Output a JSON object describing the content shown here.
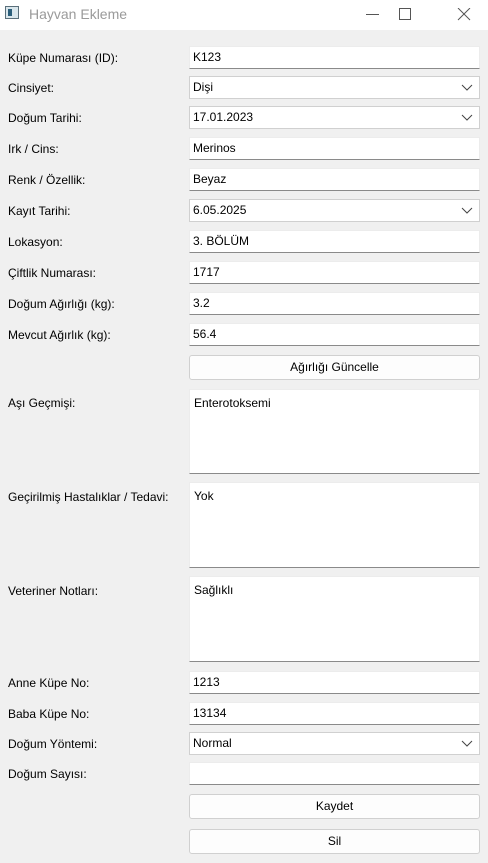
{
  "window": {
    "title": "Hayvan Ekleme",
    "icons": {
      "app": "app-window-icon",
      "minimize": "minimize-icon",
      "maximize": "maximize-icon",
      "close": "close-icon"
    }
  },
  "form": {
    "ear_tag": {
      "label": "Küpe Numarası (ID):",
      "value": "K123"
    },
    "sex": {
      "label": "Cinsiyet:",
      "value": "Dişi"
    },
    "birth_date": {
      "label": "Doğum Tarihi:",
      "value": "17.01.2023"
    },
    "breed": {
      "label": "Irk / Cins:",
      "value": "Merinos"
    },
    "color": {
      "label": "Renk / Özellik:",
      "value": "Beyaz"
    },
    "record_date": {
      "label": "Kayıt Tarihi:",
      "value": "6.05.2025"
    },
    "location": {
      "label": "Lokasyon:",
      "value": "3. BÖLÜM"
    },
    "farm_no": {
      "label": "Çiftlik Numarası:",
      "value": "1717"
    },
    "birth_weight": {
      "label": "Doğum Ağırlığı (kg):",
      "value": "3.2"
    },
    "current_weight": {
      "label": "Mevcut Ağırlık (kg):",
      "value": "56.4"
    },
    "update_weight_button": "Ağırlığı Güncelle",
    "vaccination": {
      "label": "Aşı Geçmişi:",
      "value": "Enterotoksemi"
    },
    "diseases": {
      "label": "Geçirilmiş Hastalıklar / Tedavi:",
      "value": "Yok"
    },
    "vet_notes": {
      "label": "Veteriner Notları:",
      "value": "Sağlıklı"
    },
    "mother_tag": {
      "label": "Anne Küpe No:",
      "value": "1213"
    },
    "father_tag": {
      "label": "Baba Küpe No:",
      "value": "13134"
    },
    "birth_method": {
      "label": "Doğum Yöntemi:",
      "value": "Normal"
    },
    "birth_count": {
      "label": "Doğum Sayısı:",
      "value": ""
    },
    "save_button": "Kaydet",
    "delete_button": "Sil"
  }
}
